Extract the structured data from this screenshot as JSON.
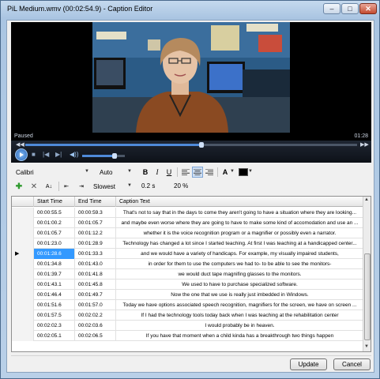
{
  "window": {
    "title": "PiL Medium.wmv (00:02:54.9) - Caption Editor",
    "minimize_label": "–",
    "maximize_label": "□",
    "close_label": "✕"
  },
  "video": {
    "status": "Paused",
    "time": "01:28"
  },
  "player": {
    "seek_fraction": 0.53,
    "volume_fraction": 0.75,
    "icons": [
      "play-icon",
      "stop-icon",
      "previous-icon",
      "next-icon",
      "volume-icon"
    ]
  },
  "format": {
    "font": "Calibri",
    "size": "Auto",
    "bold": "B",
    "italic": "I",
    "underline": "U",
    "text_color_label": "A",
    "bg_color": "#000000"
  },
  "tools": {
    "speed": "Slowest",
    "offset": "0.2 s",
    "percent": "20 %"
  },
  "grid": {
    "columns": [
      "Start Time",
      "End Time",
      "Caption Text"
    ],
    "rows": [
      {
        "start": "00:00:55.5",
        "end": "00:00:59.3",
        "text": "That's not to say that in the days to come they aren't going to have a situation where they are looking..."
      },
      {
        "start": "00:01:00.2",
        "end": "00:01:05.7",
        "text": "and maybe even worse where they are going to have to make some kind of accomodation and use an ..."
      },
      {
        "start": "00:01:05.7",
        "end": "00:01:12.2",
        "text": "whether it is the voice recognition program or a magnifier or possibly even a narrator."
      },
      {
        "start": "00:01:23.0",
        "end": "00:01:28.9",
        "text": "Technology has changed a lot since I started teaching. At first I was teaching at a handicapped center..."
      },
      {
        "start": "00:01:28.6",
        "end": "00:01:33.3",
        "text": "and we would have a variety of handicaps. For example, my visually impaired students,"
      },
      {
        "start": "00:01:34.8",
        "end": "00:01:43.0",
        "text": "in order for them to use the computers we had to- to be able to see the monitors-"
      },
      {
        "start": "00:01:39.7",
        "end": "00:01:41.8",
        "text": "we would duct tape magnifing glasses to the monitors."
      },
      {
        "start": "00:01:43.1",
        "end": "00:01:45.8",
        "text": "We used to have to purchase specialized software."
      },
      {
        "start": "00:01:46.4",
        "end": "00:01:49.7",
        "text": "Now the one that we use is really just imbedded in Windows."
      },
      {
        "start": "00:01:51.6",
        "end": "00:01:57.0",
        "text": "Today we have options associated speech recognition, magnifiers for the screen, we have on screen ..."
      },
      {
        "start": "00:01:57.5",
        "end": "00:02:02.2",
        "text": "If I had the technology tools today back when I was teaching at the rehabilitation center"
      },
      {
        "start": "00:02:02.3",
        "end": "00:02:03.6",
        "text": "I would probably be in heaven."
      },
      {
        "start": "00:02:05.1",
        "end": "00:02:06.5",
        "text": "If you have that moment when a child kinda has a breakthrough two things happen"
      }
    ]
  },
  "buttons": {
    "update": "Update",
    "cancel": "Cancel"
  },
  "colors": {
    "selection": "#3399ff",
    "player_accent": "#4f8ad8"
  }
}
